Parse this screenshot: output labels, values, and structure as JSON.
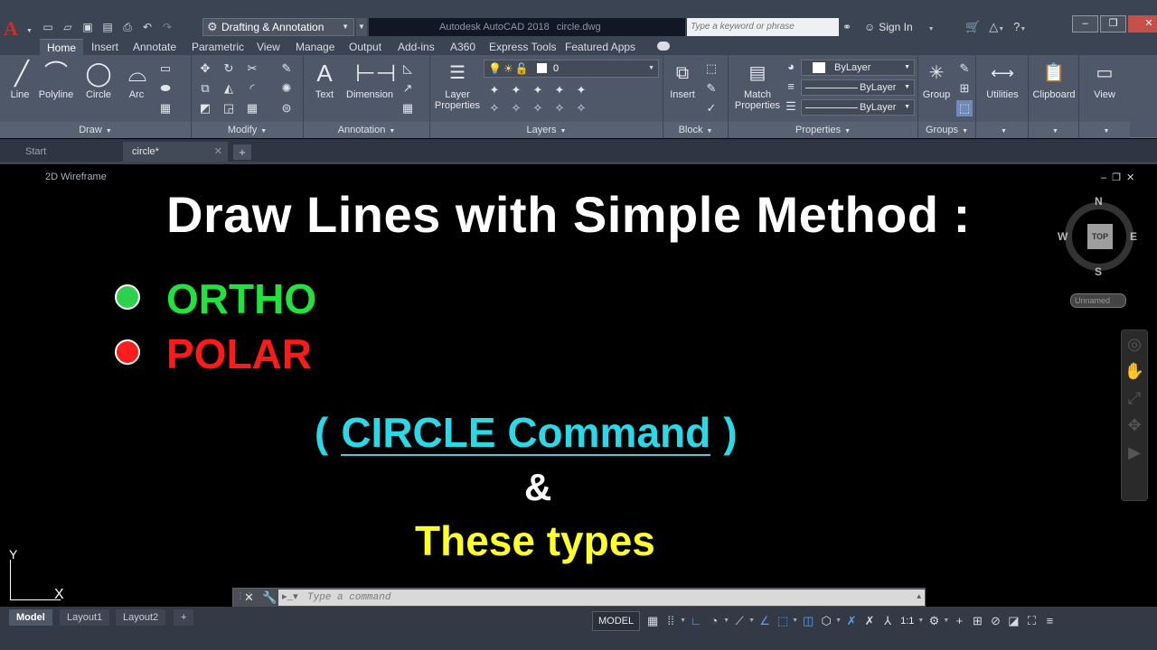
{
  "titlebar": {
    "app_logo": "A",
    "workspace": "Drafting & Annotation",
    "app_title": "Autodesk AutoCAD 2018",
    "file_name": "circle.dwg",
    "search_placeholder": "Type a keyword or phrase",
    "sign_in": "Sign In"
  },
  "ribbon_tabs": [
    "Home",
    "Insert",
    "Annotate",
    "Parametric",
    "View",
    "Manage",
    "Output",
    "Add-ins",
    "A360",
    "Express Tools",
    "Featured Apps"
  ],
  "ribbon": {
    "draw": {
      "label": "Draw",
      "line": "Line",
      "polyline": "Polyline",
      "circle": "Circle",
      "arc": "Arc"
    },
    "modify": {
      "label": "Modify"
    },
    "annotation": {
      "label": "Annotation",
      "text": "Text",
      "dimension": "Dimension"
    },
    "layers": {
      "label": "Layers",
      "layer_properties_1": "Layer",
      "layer_properties_2": "Properties",
      "current_layer": "0"
    },
    "block": {
      "label": "Block",
      "insert": "Insert"
    },
    "properties": {
      "label": "Properties",
      "match_1": "Match",
      "match_2": "Properties",
      "color": "ByLayer",
      "linetype": "ByLayer",
      "lineweight": "ByLayer"
    },
    "groups": {
      "label": "Groups",
      "group": "Group"
    },
    "utilities": "Utilities",
    "clipboard": "Clipboard",
    "view": "View"
  },
  "doc_tabs": {
    "start": "Start",
    "active": "circle*"
  },
  "canvas": {
    "view_label": "2D Wireframe",
    "headline": "Draw Lines with Simple Method :",
    "option_1": "ORTHO",
    "option_2": "POLAR",
    "paren_open": "(",
    "command_name": "CIRCLE Command",
    "paren_close": ")",
    "ampersand": "&",
    "footer": "These types",
    "colors": {
      "ortho": "#22e33e",
      "polar": "#ff1a1a",
      "command": "#29d9e8",
      "types": "#ffff2a"
    }
  },
  "viewcube": {
    "n": "N",
    "s": "S",
    "e": "E",
    "w": "W",
    "face": "TOP",
    "ucs": "Unnamed"
  },
  "ucs_icon": {
    "x": "X",
    "y": "Y"
  },
  "command_line": {
    "placeholder": "Type a command"
  },
  "status": {
    "layouts": [
      "Model",
      "Layout1",
      "Layout2"
    ],
    "model_button": "MODEL",
    "scale": "1:1"
  }
}
